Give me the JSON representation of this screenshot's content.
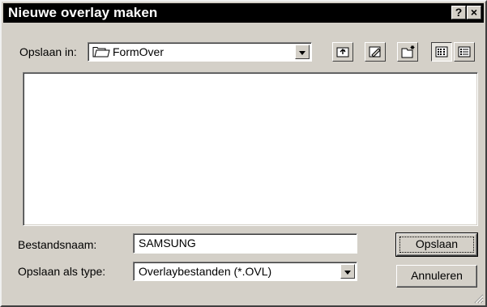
{
  "window": {
    "title": "Nieuwe overlay maken",
    "help_label": "?",
    "close_label": "×"
  },
  "save_in": {
    "label": "Opslaan in:",
    "folder": "FormOver"
  },
  "toolbar": {
    "icons": [
      "up-one-level-icon",
      "desktop-icon",
      "new-folder-icon",
      "list-view-icon",
      "details-view-icon"
    ]
  },
  "file_list": {
    "items": []
  },
  "filename": {
    "label": "Bestandsnaam:",
    "value": "SAMSUNG"
  },
  "filetype": {
    "label": "Opslaan als type:",
    "value": "Overlaybestanden (*.OVL)"
  },
  "buttons": {
    "save": "Opslaan",
    "cancel": "Annuleren"
  }
}
